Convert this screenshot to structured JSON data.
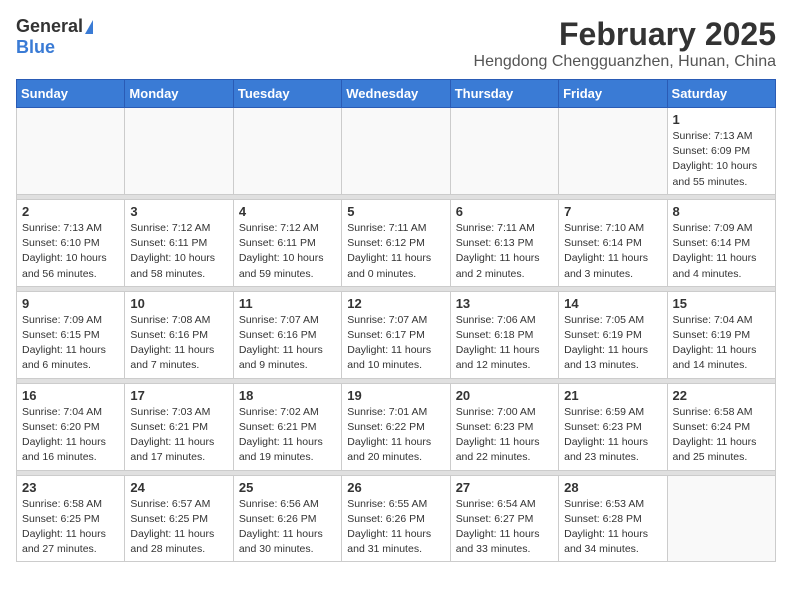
{
  "header": {
    "logo_general": "General",
    "logo_blue": "Blue",
    "month_title": "February 2025",
    "location": "Hengdong Chengguanzhen, Hunan, China"
  },
  "weekdays": [
    "Sunday",
    "Monday",
    "Tuesday",
    "Wednesday",
    "Thursday",
    "Friday",
    "Saturday"
  ],
  "weeks": [
    [
      {
        "day": "",
        "info": ""
      },
      {
        "day": "",
        "info": ""
      },
      {
        "day": "",
        "info": ""
      },
      {
        "day": "",
        "info": ""
      },
      {
        "day": "",
        "info": ""
      },
      {
        "day": "",
        "info": ""
      },
      {
        "day": "1",
        "info": "Sunrise: 7:13 AM\nSunset: 6:09 PM\nDaylight: 10 hours\nand 55 minutes."
      }
    ],
    [
      {
        "day": "2",
        "info": "Sunrise: 7:13 AM\nSunset: 6:10 PM\nDaylight: 10 hours\nand 56 minutes."
      },
      {
        "day": "3",
        "info": "Sunrise: 7:12 AM\nSunset: 6:11 PM\nDaylight: 10 hours\nand 58 minutes."
      },
      {
        "day": "4",
        "info": "Sunrise: 7:12 AM\nSunset: 6:11 PM\nDaylight: 10 hours\nand 59 minutes."
      },
      {
        "day": "5",
        "info": "Sunrise: 7:11 AM\nSunset: 6:12 PM\nDaylight: 11 hours\nand 0 minutes."
      },
      {
        "day": "6",
        "info": "Sunrise: 7:11 AM\nSunset: 6:13 PM\nDaylight: 11 hours\nand 2 minutes."
      },
      {
        "day": "7",
        "info": "Sunrise: 7:10 AM\nSunset: 6:14 PM\nDaylight: 11 hours\nand 3 minutes."
      },
      {
        "day": "8",
        "info": "Sunrise: 7:09 AM\nSunset: 6:14 PM\nDaylight: 11 hours\nand 4 minutes."
      }
    ],
    [
      {
        "day": "9",
        "info": "Sunrise: 7:09 AM\nSunset: 6:15 PM\nDaylight: 11 hours\nand 6 minutes."
      },
      {
        "day": "10",
        "info": "Sunrise: 7:08 AM\nSunset: 6:16 PM\nDaylight: 11 hours\nand 7 minutes."
      },
      {
        "day": "11",
        "info": "Sunrise: 7:07 AM\nSunset: 6:16 PM\nDaylight: 11 hours\nand 9 minutes."
      },
      {
        "day": "12",
        "info": "Sunrise: 7:07 AM\nSunset: 6:17 PM\nDaylight: 11 hours\nand 10 minutes."
      },
      {
        "day": "13",
        "info": "Sunrise: 7:06 AM\nSunset: 6:18 PM\nDaylight: 11 hours\nand 12 minutes."
      },
      {
        "day": "14",
        "info": "Sunrise: 7:05 AM\nSunset: 6:19 PM\nDaylight: 11 hours\nand 13 minutes."
      },
      {
        "day": "15",
        "info": "Sunrise: 7:04 AM\nSunset: 6:19 PM\nDaylight: 11 hours\nand 14 minutes."
      }
    ],
    [
      {
        "day": "16",
        "info": "Sunrise: 7:04 AM\nSunset: 6:20 PM\nDaylight: 11 hours\nand 16 minutes."
      },
      {
        "day": "17",
        "info": "Sunrise: 7:03 AM\nSunset: 6:21 PM\nDaylight: 11 hours\nand 17 minutes."
      },
      {
        "day": "18",
        "info": "Sunrise: 7:02 AM\nSunset: 6:21 PM\nDaylight: 11 hours\nand 19 minutes."
      },
      {
        "day": "19",
        "info": "Sunrise: 7:01 AM\nSunset: 6:22 PM\nDaylight: 11 hours\nand 20 minutes."
      },
      {
        "day": "20",
        "info": "Sunrise: 7:00 AM\nSunset: 6:23 PM\nDaylight: 11 hours\nand 22 minutes."
      },
      {
        "day": "21",
        "info": "Sunrise: 6:59 AM\nSunset: 6:23 PM\nDaylight: 11 hours\nand 23 minutes."
      },
      {
        "day": "22",
        "info": "Sunrise: 6:58 AM\nSunset: 6:24 PM\nDaylight: 11 hours\nand 25 minutes."
      }
    ],
    [
      {
        "day": "23",
        "info": "Sunrise: 6:58 AM\nSunset: 6:25 PM\nDaylight: 11 hours\nand 27 minutes."
      },
      {
        "day": "24",
        "info": "Sunrise: 6:57 AM\nSunset: 6:25 PM\nDaylight: 11 hours\nand 28 minutes."
      },
      {
        "day": "25",
        "info": "Sunrise: 6:56 AM\nSunset: 6:26 PM\nDaylight: 11 hours\nand 30 minutes."
      },
      {
        "day": "26",
        "info": "Sunrise: 6:55 AM\nSunset: 6:26 PM\nDaylight: 11 hours\nand 31 minutes."
      },
      {
        "day": "27",
        "info": "Sunrise: 6:54 AM\nSunset: 6:27 PM\nDaylight: 11 hours\nand 33 minutes."
      },
      {
        "day": "28",
        "info": "Sunrise: 6:53 AM\nSunset: 6:28 PM\nDaylight: 11 hours\nand 34 minutes."
      },
      {
        "day": "",
        "info": ""
      }
    ]
  ]
}
